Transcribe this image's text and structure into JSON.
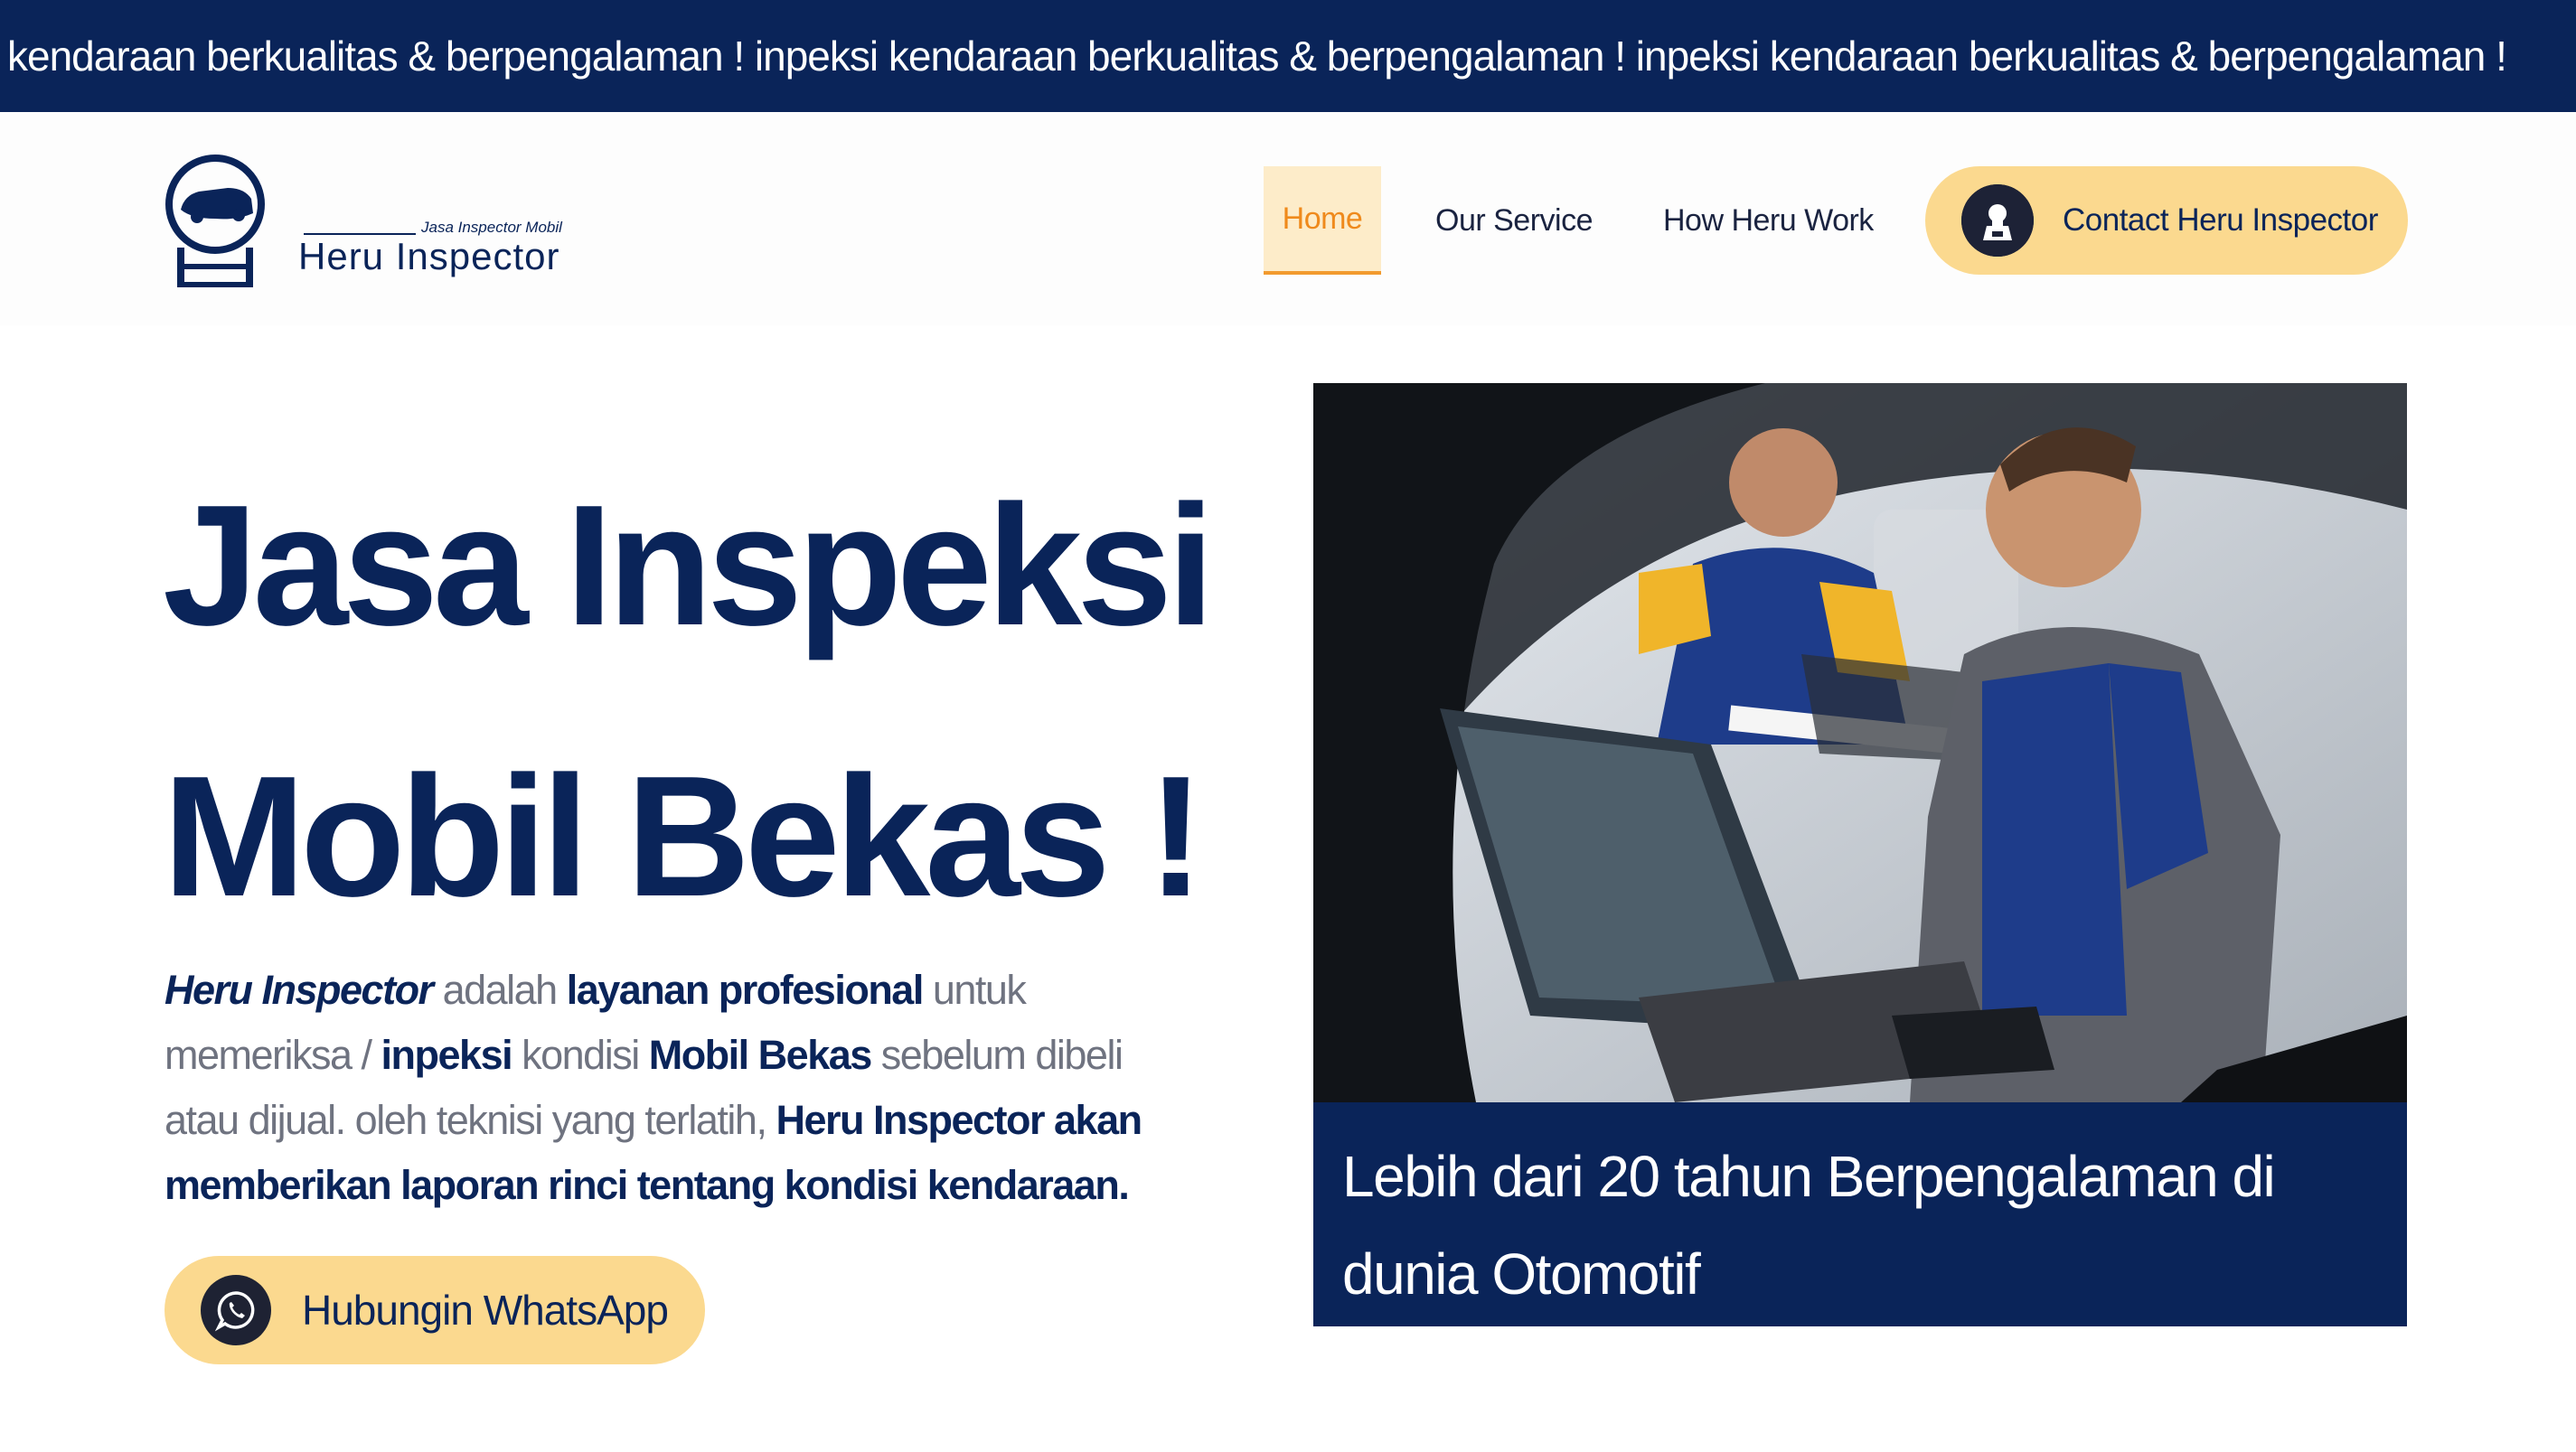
{
  "ticker": {
    "text": "kendaraan berkualitas & berpengalaman ! inpeksi kendaraan berkualitas & berpengalaman ! inpeksi kendaraan berkualitas & berpengalaman !"
  },
  "logo": {
    "tagline": "Jasa Inspector Mobil",
    "name": "Heru Inspector"
  },
  "nav": {
    "home": "Home",
    "service": "Our Service",
    "how": "How Heru Work",
    "contact": "Contact Heru Inspector"
  },
  "hero": {
    "title_line1": "Jasa Inspeksi",
    "title_line2": "Mobil Bekas !",
    "desc": {
      "p1": "Heru Inspector",
      "p2": " adalah ",
      "p3": "layanan profesional",
      "p4": " untuk memeriksa / ",
      "p5": "inpeksi",
      "p6": " kondisi ",
      "p7": "Mobil Bekas",
      "p8": " sebelum dibeli atau dijual. oleh teknisi yang terlatih, ",
      "p9": "Heru Inspector akan memberikan laporan rinci tentang kondisi kendaraan."
    },
    "whatsapp_label": "Hubungin WhatsApp"
  },
  "photo": {
    "caption": "Lebih dari 20 tahun Berpengalaman di dunia Otomotif"
  },
  "colors": {
    "navy": "#0a2459",
    "accent_yellow": "#fbd98f",
    "home_orange": "#ef8a1c"
  }
}
